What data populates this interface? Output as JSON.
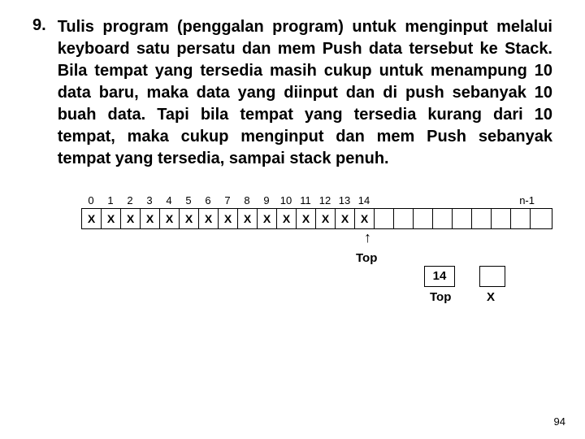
{
  "question": {
    "number": "9.",
    "text": "Tulis program (penggalan program) untuk menginput melalui keyboard satu persatu dan mem Push data tersebut ke Stack. Bila tempat yang tersedia masih cukup untuk menampung 10 data baru, maka data yang diinput dan di push sebanyak 10 buah data. Tapi bila tempat yang tersedia kurang dari 10 tempat, maka cukup menginput dan mem Push sebanyak tempat yang tersedia, sampai stack penuh."
  },
  "stack": {
    "indices": [
      "0",
      "1",
      "2",
      "3",
      "4",
      "5",
      "6",
      "7",
      "8",
      "9",
      "10",
      "11",
      "12",
      "13",
      "14"
    ],
    "n_label": "n-1",
    "cells": [
      "X",
      "X",
      "X",
      "X",
      "X",
      "X",
      "X",
      "X",
      "X",
      "X",
      "X",
      "X",
      "X",
      "X",
      "X",
      "",
      "",
      "",
      "",
      "",
      "",
      "",
      "",
      ""
    ],
    "arrow_label": "Top",
    "top_box_value": "14",
    "top_box_label": "Top",
    "x_box_label": "X"
  },
  "page_number": "94"
}
